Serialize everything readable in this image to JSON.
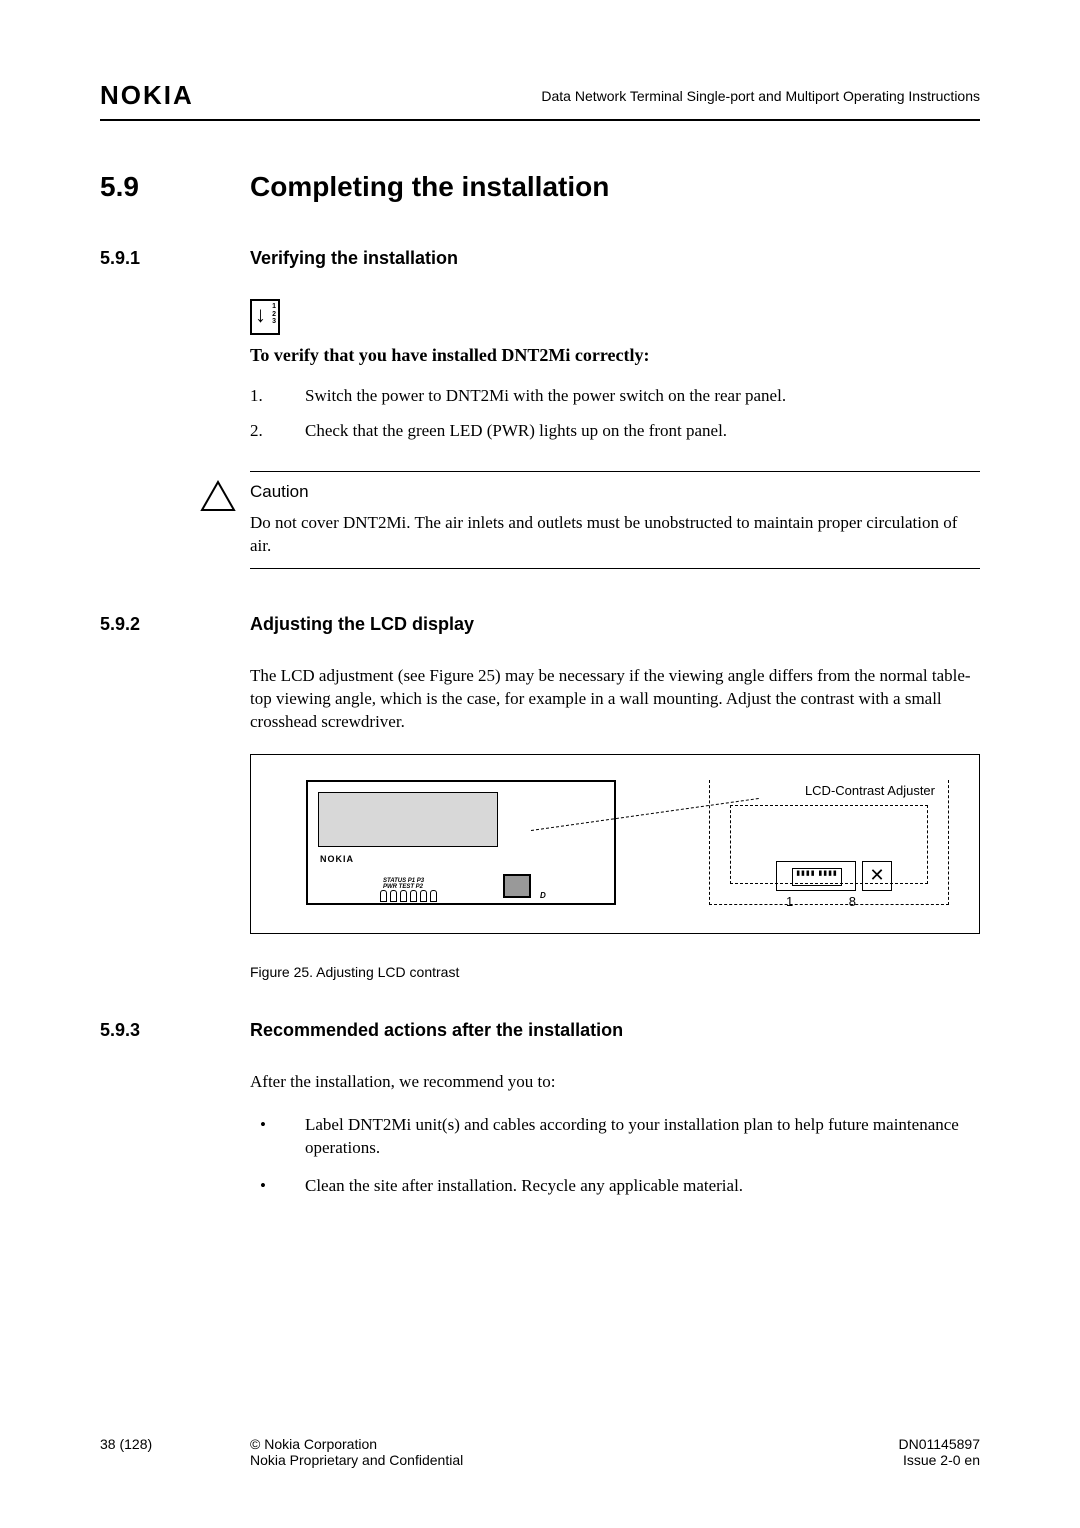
{
  "header": {
    "logo": "NOKIA",
    "docTitle": "Data Network Terminal Single-port and Multiport Operating Instructions"
  },
  "section": {
    "number": "5.9",
    "title": "Completing the installation"
  },
  "sub1": {
    "number": "5.9.1",
    "title": "Verifying the installation",
    "stepNums": "1\n2\n3",
    "intro": "To verify that you have installed DNT2Mi correctly:",
    "steps": [
      {
        "n": "1.",
        "text": "Switch the power to DNT2Mi with the power switch on the rear panel."
      },
      {
        "n": "2.",
        "text": "Check that the green LED (PWR) lights up on the front panel."
      }
    ]
  },
  "caution": {
    "title": "Caution",
    "text": "Do not cover DNT2Mi. The air inlets and outlets must be unobstructed to maintain proper circulation of air."
  },
  "sub2": {
    "number": "5.9.2",
    "title": "Adjusting the LCD display",
    "para": "The LCD adjustment (see Figure 25) may be necessary if the viewing angle differs from the normal table-top viewing angle, which is the case, for example in a wall mounting. Adjust the contrast with a small crosshead screwdriver.",
    "figure": {
      "brand": "NOKIA",
      "labelsTop": "STATUS P1   P3",
      "labelsBot": "PWR  TEST P2",
      "dlabel": "D",
      "adjuster": "LCD-Contrast Adjuster",
      "connPins": "▮▮▮▮ ▮▮▮▮",
      "num1": "1",
      "num8": "8",
      "screw": "✕"
    },
    "figCaption": "Figure 25.    Adjusting LCD contrast"
  },
  "sub3": {
    "number": "5.9.3",
    "title": "Recommended actions after the installation",
    "para": "After the installation, we recommend you to:",
    "bullets": [
      "Label DNT2Mi unit(s) and cables according to your installation plan to help future maintenance operations.",
      "Clean the site after installation. Recycle any applicable material."
    ]
  },
  "footer": {
    "pageNum": "38 (128)",
    "copyright": "© Nokia Corporation",
    "confidential": "Nokia Proprietary and Confidential",
    "docId": "DN01145897",
    "issue": "Issue 2-0 en"
  }
}
